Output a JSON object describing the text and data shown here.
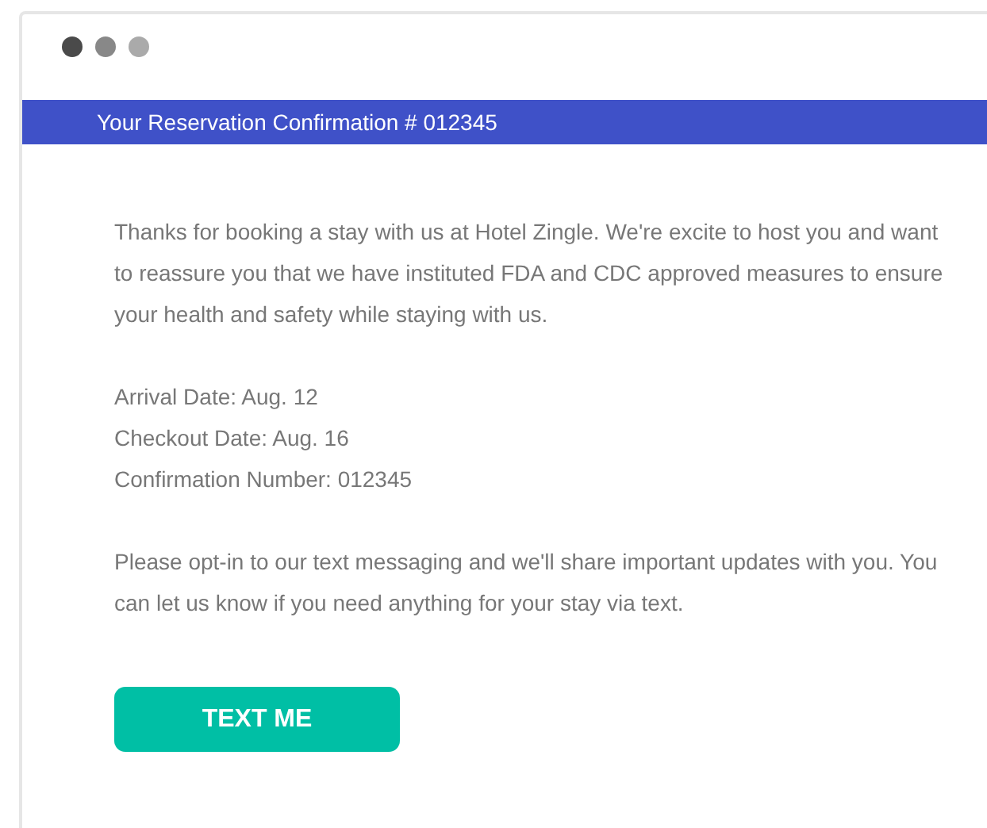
{
  "window": {
    "dots": [
      {
        "color": "#4a4a4a"
      },
      {
        "color": "#888888"
      },
      {
        "color": "#aaaaaa"
      }
    ]
  },
  "header": {
    "title": "Your Reservation Confirmation # 012345"
  },
  "intro": "Thanks for booking a stay with us at Hotel Zingle. We're excite to host you and want to reassure you that we have instituted FDA and CDC approved measures to ensure your health and safety while staying with us.",
  "details": [
    "Arrival Date: Aug. 12",
    "Checkout Date: Aug. 16",
    "Confirmation Number: 012345"
  ],
  "optin": "Please opt-in to our text messaging and we'll share important updates with you. You can let us know if you need anything for your stay via text.",
  "button": {
    "label": "TEXT ME"
  }
}
